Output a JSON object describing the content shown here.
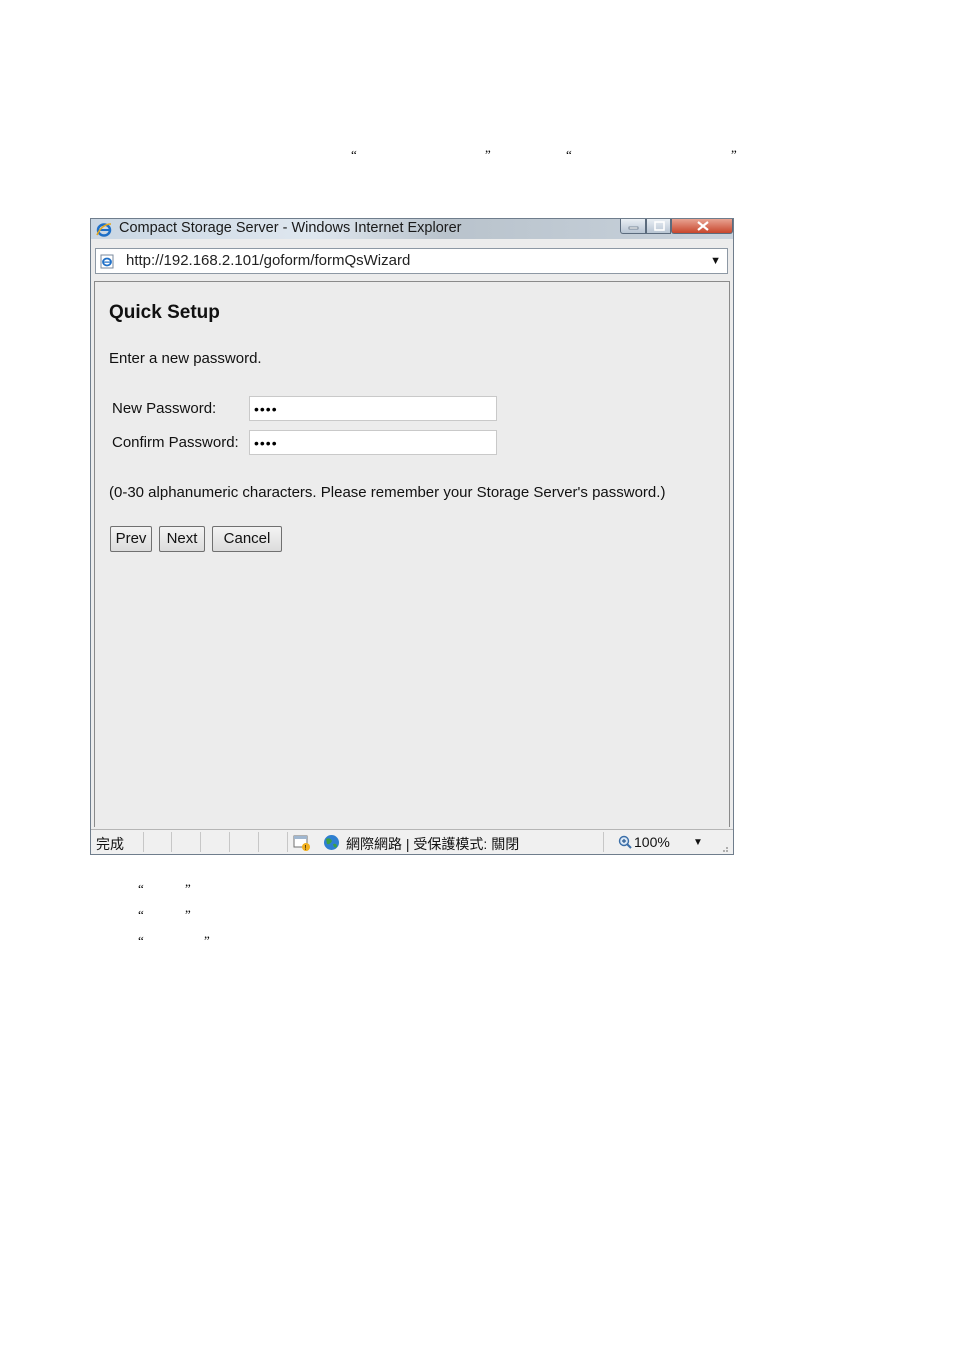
{
  "doc": {
    "top_quotes": [
      "“",
      "”",
      "“",
      "”"
    ],
    "bottom_quotes": [
      [
        "“",
        "”"
      ],
      [
        "“",
        "”"
      ],
      [
        "“",
        "”"
      ]
    ]
  },
  "browser": {
    "title": "Compact Storage Server - Windows Internet Explorer",
    "url": "http://192.168.2.101/goform/formQsWizard",
    "status_text": "完成",
    "zone_text": "網際網路 | 受保護模式: 關閉",
    "zoom": "100%"
  },
  "page": {
    "title": "Quick Setup",
    "intro": "Enter a new password.",
    "new_password_label": "New Password:",
    "new_password_value": "••••",
    "confirm_password_label": "Confirm Password:",
    "confirm_password_value": "••••",
    "hint": "(0-30 alphanumeric characters. Please remember your Storage Server's password.)",
    "prev_label": "Prev",
    "next_label": "Next",
    "cancel_label": "Cancel"
  },
  "icons": [
    "ie-logo-icon",
    "page-icon",
    "minimize-icon",
    "maximize-icon",
    "close-icon",
    "dropdown-arrow-icon",
    "security-report-icon",
    "globe-icon",
    "zoom-icon"
  ],
  "colors": {
    "close_button": "#c8462c",
    "content_bg": "#ececec"
  }
}
